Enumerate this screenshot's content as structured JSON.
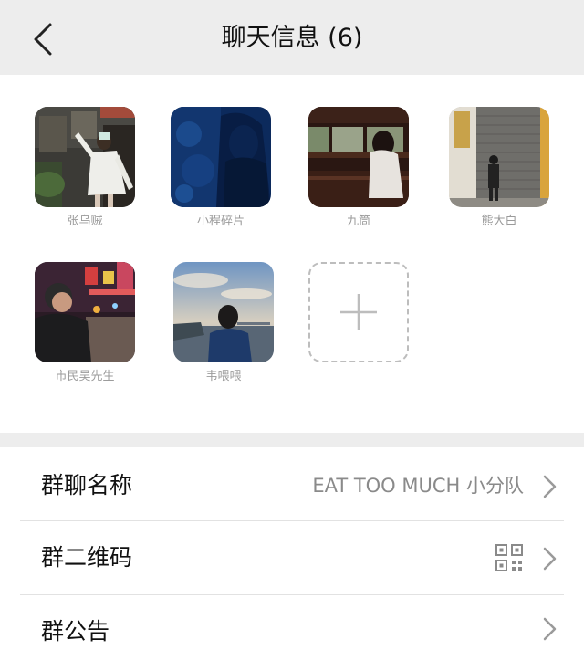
{
  "header": {
    "title": "聊天信息 (6)",
    "back_icon": "chevron-left-icon"
  },
  "members": [
    {
      "name": "张乌贼"
    },
    {
      "name": "小程碎片"
    },
    {
      "name": "九筒"
    },
    {
      "name": "熊大白"
    },
    {
      "name": "市民吴先生"
    },
    {
      "name": "韦喂喂"
    }
  ],
  "add_member": {
    "icon": "plus-icon"
  },
  "settings": [
    {
      "label": "群聊名称",
      "value": "EAT TOO MUCH 小分队",
      "icon": "chevron-right-icon"
    },
    {
      "label": "群二维码",
      "value": "",
      "icon": "qr-code-icon"
    },
    {
      "label": "群公告",
      "value": "",
      "icon": "chevron-right-icon"
    }
  ],
  "colors": {
    "nav_bg": "#ededed",
    "text_primary": "#111111",
    "text_secondary": "#8a8a8a",
    "member_name": "#9b9b9b"
  }
}
